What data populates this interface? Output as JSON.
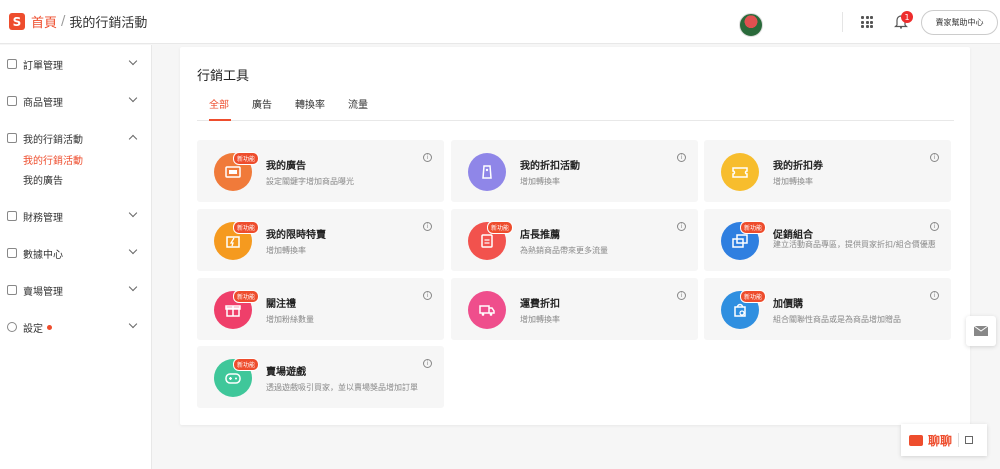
{
  "header": {
    "logo_letter": "S",
    "breadcrumb_home": "首頁",
    "breadcrumb_sep": "/",
    "breadcrumb_current": "我的行銷活動",
    "notification_count": "1",
    "help_button": "賣家幫助中心"
  },
  "sidebar": {
    "items": [
      {
        "label": "訂單管理"
      },
      {
        "label": "商品管理"
      },
      {
        "label": "我的行銷活動"
      },
      {
        "label": "財務管理"
      },
      {
        "label": "數據中心"
      },
      {
        "label": "賣場管理"
      },
      {
        "label": "設定"
      }
    ],
    "sub_items": [
      {
        "label": "我的行銷活動"
      },
      {
        "label": "我的廣告"
      }
    ]
  },
  "main": {
    "title": "行銷工具",
    "tabs": [
      {
        "label": "全部"
      },
      {
        "label": "廣告"
      },
      {
        "label": "轉換率"
      },
      {
        "label": "流量"
      }
    ],
    "new_badge": "新功能",
    "info_symbol": "i",
    "tools": [
      {
        "name": "我的廣告",
        "desc": "設定關鍵字增加商品曝光",
        "color": "#f07a3a"
      },
      {
        "name": "我的折扣活動",
        "desc": "增加轉換率",
        "color": "#8f86e8"
      },
      {
        "name": "我的折扣券",
        "desc": "增加轉換率",
        "color": "#f7bd2d"
      },
      {
        "name": "我的限時特賣",
        "desc": "增加轉換率",
        "color": "#f59a1f"
      },
      {
        "name": "店長推薦",
        "desc": "為熱銷商品帶來更多流量",
        "color": "#f2524d"
      },
      {
        "name": "促銷組合",
        "desc": "建立活動商品專區，提供買家折扣/組合價優惠",
        "color": "#2f7fe0"
      },
      {
        "name": "關注禮",
        "desc": "增加粉絲數量",
        "color": "#ef3f6a"
      },
      {
        "name": "運費折扣",
        "desc": "增加轉換率",
        "color": "#ef4e8c"
      },
      {
        "name": "加價購",
        "desc": "組合關聯性商品或是為商品增加贈品",
        "color": "#2f8fe0"
      },
      {
        "name": "賣場遊戲",
        "desc": "透過遊戲吸引買家，並以賣場獎品增加訂單",
        "color": "#3fc79a"
      }
    ]
  },
  "chat": {
    "label": "聊聊"
  },
  "colors": {
    "accent": "#ee4d2d"
  }
}
